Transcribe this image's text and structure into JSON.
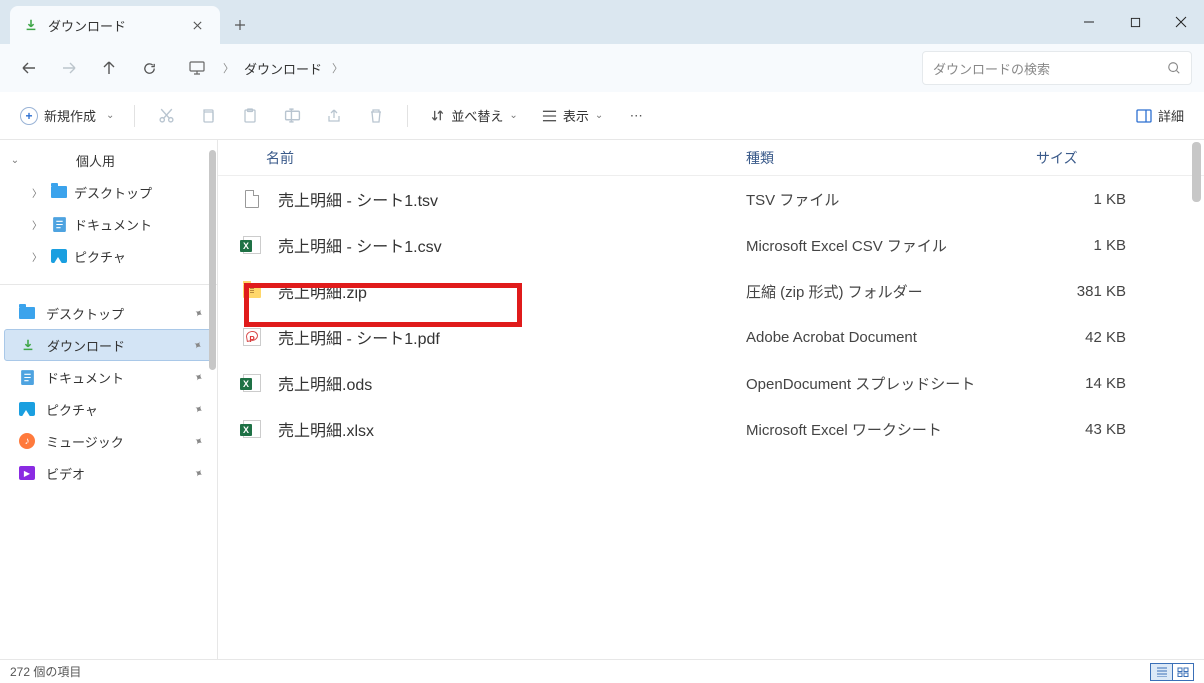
{
  "window": {
    "tab_title": "ダウンロード"
  },
  "breadcrumb": {
    "current": "ダウンロード"
  },
  "search": {
    "placeholder": "ダウンロードの検索"
  },
  "toolbar": {
    "new_label": "新規作成",
    "sort_label": "並べ替え",
    "view_label": "表示",
    "details_label": "詳細"
  },
  "tree": {
    "root": "個人用",
    "items": [
      {
        "label": "デスクトップ",
        "icon": "folder-blue"
      },
      {
        "label": "ドキュメント",
        "icon": "doc-blue"
      },
      {
        "label": "ピクチャ",
        "icon": "pic-blue"
      }
    ]
  },
  "quick": [
    {
      "label": "デスクトップ",
      "icon": "folder-blue",
      "active": false
    },
    {
      "label": "ダウンロード",
      "icon": "download",
      "active": true
    },
    {
      "label": "ドキュメント",
      "icon": "doc-blue",
      "active": false
    },
    {
      "label": "ピクチャ",
      "icon": "pic-blue",
      "active": false
    },
    {
      "label": "ミュージック",
      "icon": "music",
      "active": false
    },
    {
      "label": "ビデオ",
      "icon": "video",
      "active": false
    }
  ],
  "columns": {
    "name": "名前",
    "type": "種類",
    "size": "サイズ"
  },
  "files": [
    {
      "name": "売上明細 - シート1.tsv",
      "type": "TSV ファイル",
      "size": "1 KB",
      "icon": "doc",
      "highlight": false
    },
    {
      "name": "売上明細 - シート1.csv",
      "type": "Microsoft Excel CSV ファイル",
      "size": "1 KB",
      "icon": "excel",
      "highlight": false
    },
    {
      "name": "売上明細.zip",
      "type": "圧縮 (zip 形式) フォルダー",
      "size": "381 KB",
      "icon": "zip",
      "highlight": true
    },
    {
      "name": "売上明細 - シート1.pdf",
      "type": "Adobe Acrobat Document",
      "size": "42 KB",
      "icon": "pdf",
      "highlight": false
    },
    {
      "name": "売上明細.ods",
      "type": "OpenDocument スプレッドシート",
      "size": "14 KB",
      "icon": "excel",
      "highlight": false
    },
    {
      "name": "売上明細.xlsx",
      "type": "Microsoft Excel ワークシート",
      "size": "43 KB",
      "icon": "excel",
      "highlight": false
    }
  ],
  "statusbar": {
    "item_count": "272 個の項目"
  }
}
